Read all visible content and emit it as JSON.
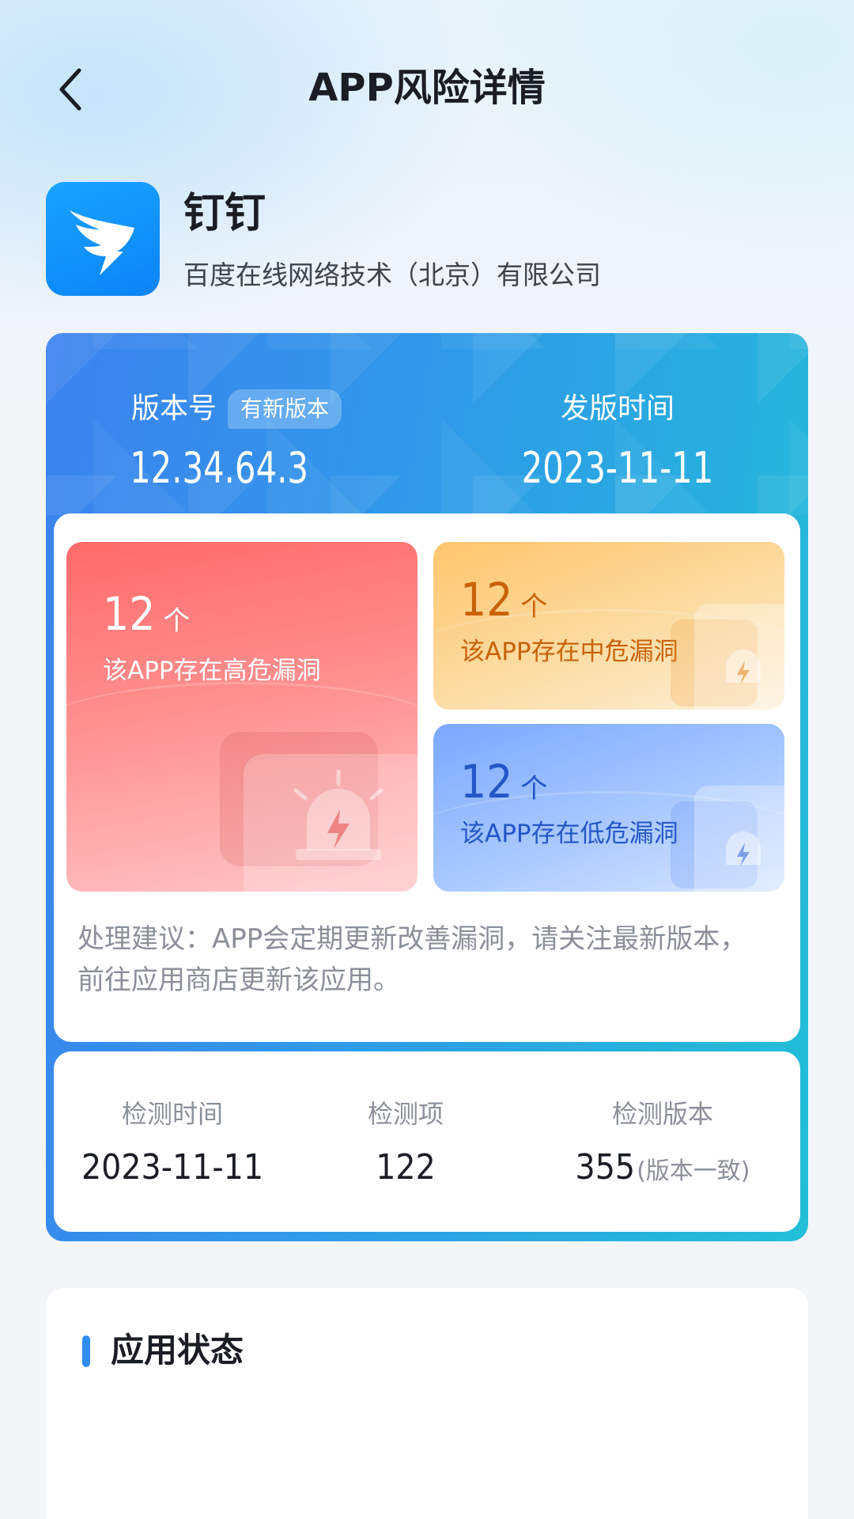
{
  "header": {
    "title": "APP风险详情",
    "back_icon": "chevron-left-icon"
  },
  "app": {
    "name": "钉钉",
    "company": "百度在线网络技术（北京）有限公司",
    "icon": "dingtalk-logo-icon",
    "icon_color": "#0a84f6"
  },
  "version_info": {
    "version_label": "版本号",
    "new_version_badge": "有新版本",
    "version_value": "12.34.64.3",
    "release_label": "发版时间",
    "release_value": "2023-11-11"
  },
  "vulnerabilities": {
    "high": {
      "count": "12",
      "unit": "个",
      "desc": "该APP存在高危漏洞",
      "color": "#ff6a6a"
    },
    "medium": {
      "count": "12",
      "unit": "个",
      "desc": "该APP存在中危漏洞",
      "color": "#c8620a"
    },
    "low": {
      "count": "12",
      "unit": "个",
      "desc": "该APP存在低危漏洞",
      "color": "#2456c6"
    }
  },
  "advice": "处理建议：APP会定期更新改善漏洞，请关注最新版本，前往应用商店更新该应用。",
  "detection": {
    "time_label": "检测时间",
    "time_value": "2023-11-11",
    "items_label": "检测项",
    "items_value": "122",
    "version_label": "检测版本",
    "version_value": "355",
    "version_suffix": "(版本一致)"
  },
  "status_section": {
    "title": "应用状态",
    "accent_color": "#2f8cf0"
  }
}
